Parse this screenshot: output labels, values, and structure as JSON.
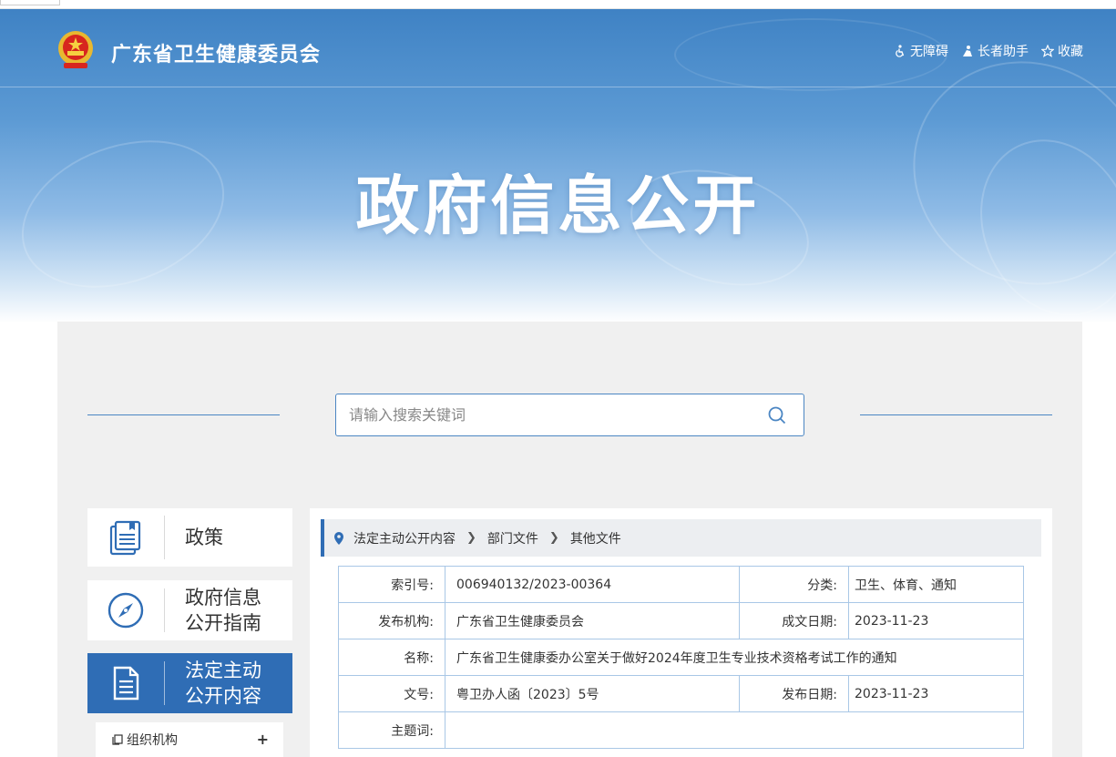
{
  "header": {
    "site_name": "广东省卫生健康委员会",
    "tools": [
      {
        "label": "无障碍",
        "icon": "accessibility-icon"
      },
      {
        "label": "长者助手",
        "icon": "elder-assist-icon"
      },
      {
        "label": "收藏",
        "icon": "star-icon"
      }
    ]
  },
  "banner": {
    "title": "政府信息公开"
  },
  "search": {
    "placeholder": "请输入搜索关键词"
  },
  "nav": {
    "items": [
      {
        "label": "政策",
        "icon": "document-stack-icon",
        "active": false
      },
      {
        "label": "政府信息公开指南",
        "icon": "compass-icon",
        "active": false
      },
      {
        "label": "法定主动公开内容",
        "icon": "document-icon",
        "active": true
      }
    ],
    "sub_items": [
      {
        "label": "组织机构",
        "expand": "+"
      }
    ]
  },
  "breadcrumb": [
    "法定主动公开内容",
    "部门文件",
    "其他文件"
  ],
  "meta": {
    "index_no_label": "索引号:",
    "index_no": "006940132/2023-00364",
    "category_label": "分类:",
    "category": "卫生、体育、通知",
    "issuer_label": "发布机构:",
    "issuer": "广东省卫生健康委员会",
    "created_label": "成文日期:",
    "created": "2023-11-23",
    "name_label": "名称:",
    "name": "广东省卫生健康委办公室关于做好2024年度卫生专业技术资格考试工作的通知",
    "doc_no_label": "文号:",
    "doc_no": "粤卫办人函〔2023〕5号",
    "published_label": "发布日期:",
    "published": "2023-11-23",
    "subject_label": "主题词:",
    "subject": ""
  },
  "colors": {
    "accent": "#2f6db5",
    "border": "#a9c7e6",
    "panel_bg": "#f0f0f0"
  }
}
